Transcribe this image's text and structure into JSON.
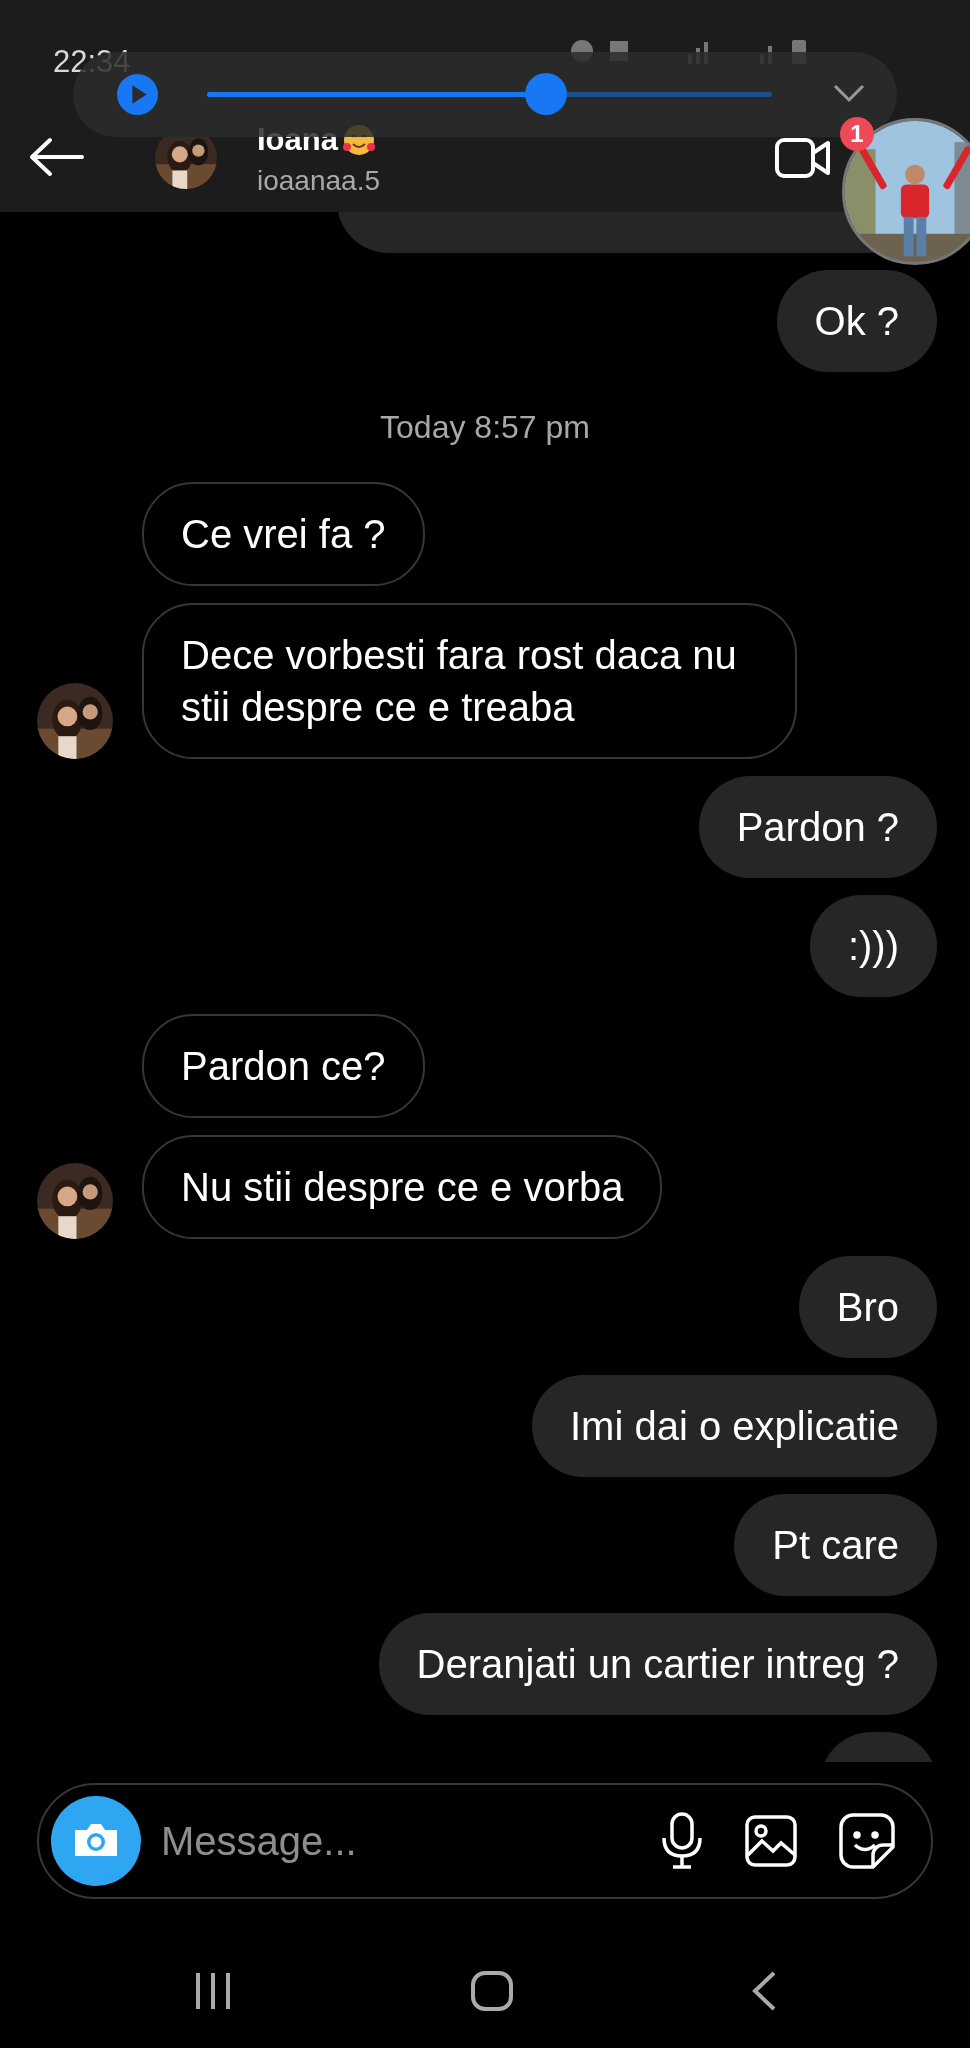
{
  "status_bar": {
    "time": "22:34"
  },
  "media_player": {
    "level": 0.6
  },
  "header": {
    "name": "Ioana",
    "username": "ioaanaa.5"
  },
  "chat_head": {
    "badge": "1"
  },
  "messages": [
    {
      "kind": "sent",
      "text": "Ok ?"
    },
    {
      "kind": "timestamp",
      "text": "Today 8:57 pm"
    },
    {
      "kind": "received",
      "text": "Ce vrei fa ?",
      "avatar": false
    },
    {
      "kind": "received",
      "text": "Dece vorbesti fara rost daca nu stii despre ce e treaba",
      "avatar": true
    },
    {
      "kind": "sent",
      "text": "Pardon ?"
    },
    {
      "kind": "sent",
      "text": ":)))"
    },
    {
      "kind": "received",
      "text": "Pardon ce?",
      "avatar": false
    },
    {
      "kind": "received",
      "text": "Nu stii despre ce e vorba",
      "avatar": true
    },
    {
      "kind": "sent",
      "text": "Bro"
    },
    {
      "kind": "sent",
      "text": "Imi dai o explicatie"
    },
    {
      "kind": "sent",
      "text": "Pt care"
    },
    {
      "kind": "sent",
      "text": "Deranjati un cartier intreg ?"
    }
  ],
  "composer": {
    "placeholder": "Message..."
  }
}
